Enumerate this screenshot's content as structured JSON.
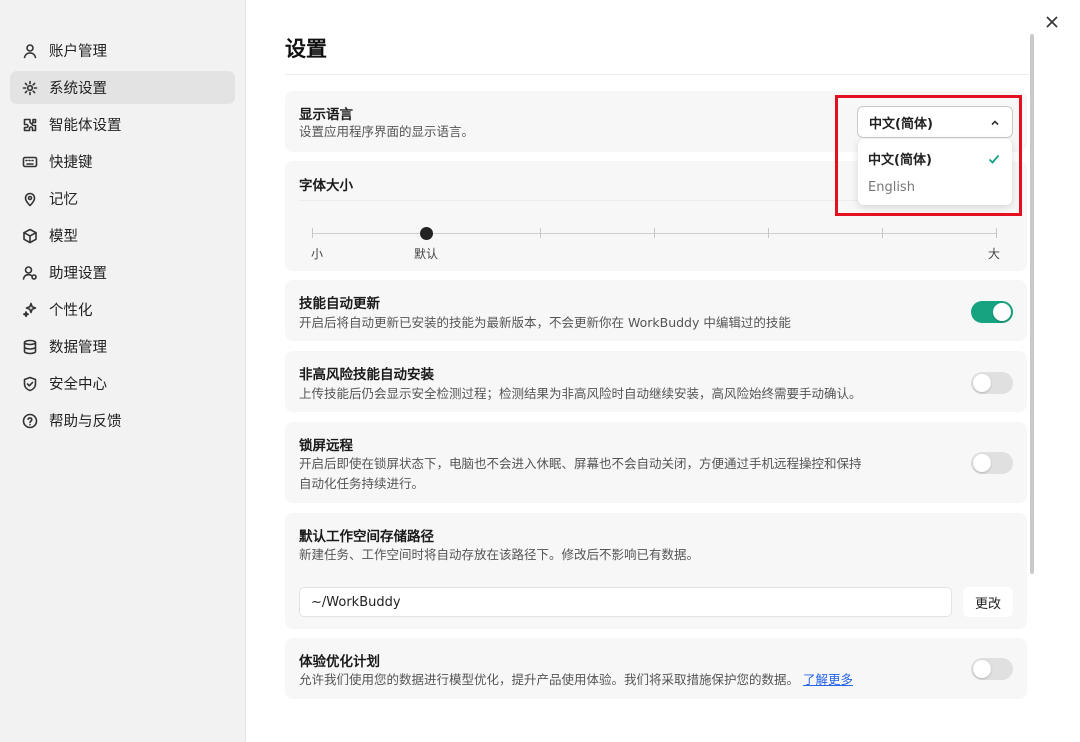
{
  "sidebar": {
    "items": [
      {
        "label": "账户管理",
        "icon": "user-icon"
      },
      {
        "label": "系统设置",
        "icon": "gear-icon"
      },
      {
        "label": "智能体设置",
        "icon": "agent-icon"
      },
      {
        "label": "快捷键",
        "icon": "keyboard-icon"
      },
      {
        "label": "记忆",
        "icon": "memory-icon"
      },
      {
        "label": "模型",
        "icon": "cube-icon"
      },
      {
        "label": "助理设置",
        "icon": "assistant-icon"
      },
      {
        "label": "个性化",
        "icon": "sparkle-icon"
      },
      {
        "label": "数据管理",
        "icon": "database-icon"
      },
      {
        "label": "安全中心",
        "icon": "shield-icon"
      },
      {
        "label": "帮助与反馈",
        "icon": "help-icon"
      }
    ],
    "active_index": 1
  },
  "main": {
    "title": "设置",
    "language": {
      "title": "显示语言",
      "desc": "设置应用程序界面的显示语言。",
      "selected": "中文(简体)",
      "options": [
        "中文(简体)",
        "English"
      ]
    },
    "font_size": {
      "title": "字体大小",
      "label_small": "小",
      "label_default": "默认",
      "label_large": "大",
      "steps": 7,
      "value_index": 1
    },
    "skill_update": {
      "title": "技能自动更新",
      "desc": "开启后将自动更新已安装的技能为最新版本，不会更新你在 WorkBuddy 中编辑过的技能",
      "enabled": true
    },
    "auto_install": {
      "title": "非高风险技能自动安装",
      "desc": "上传技能后仍会显示安全检测过程；检测结果为非高风险时自动继续安装，高风险始终需要手动确认。",
      "enabled": false
    },
    "lock_remote": {
      "title": "锁屏远程",
      "desc_line1": "开启后即使在锁屏状态下，电脑也不会进入休眠、屏幕也不会自动关闭，方便通过手机远程操控和保持",
      "desc_line2": "自动化任务持续进行。",
      "enabled": false
    },
    "workspace": {
      "title": "默认工作空间存储路径",
      "desc": "新建任务、工作空间时将自动存放在该路径下。修改后不影响已有数据。",
      "path": "~/WorkBuddy",
      "change_label": "更改"
    },
    "experience": {
      "title": "体验优化计划",
      "desc": "允许我们使用您的数据进行模型优化，提升产品使用体验。我们将采取措施保护您的数据。",
      "link": "了解更多",
      "enabled": false
    }
  },
  "colors": {
    "accent": "#16a37f",
    "highlight": "#e3101f",
    "link": "#2563eb"
  }
}
